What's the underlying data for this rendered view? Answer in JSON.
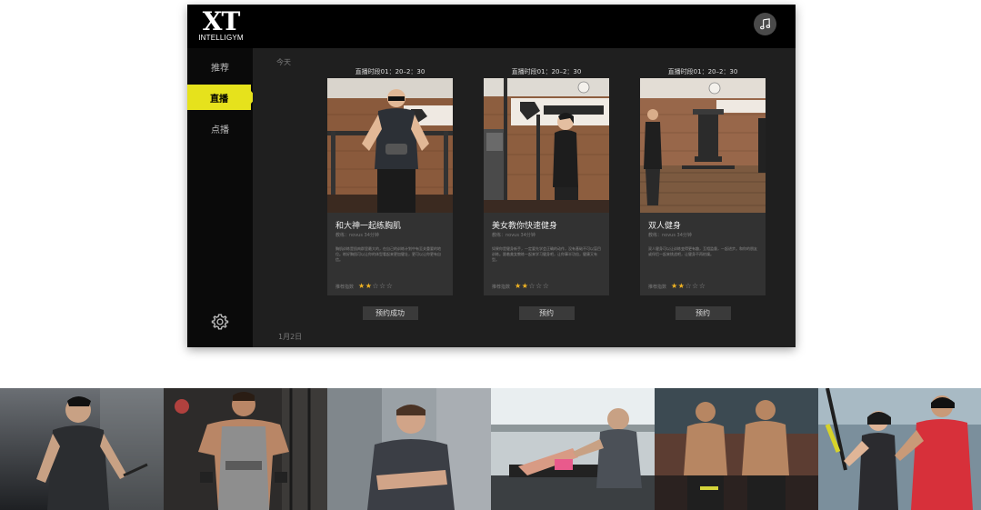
{
  "app": {
    "logo": {
      "main": "XT",
      "sub": "INTELLIGYM"
    },
    "sidebar": {
      "items": [
        {
          "label": "推荐",
          "active": false
        },
        {
          "label": "直播",
          "active": true
        },
        {
          "label": "点播",
          "active": false
        }
      ]
    },
    "main": {
      "date_top": "今天",
      "date_bottom": "1月2日",
      "cards": [
        {
          "time": "直播时段01：20–2：30",
          "title": "和大神一起练胸肌",
          "coach": "教练：novus 34分钟",
          "description": "胸肌训练是肌肉群里最大的，在自己的训练计划中有至关重要的地位。练好胸肌可以让你的体型看起来更加健壮，更可以让你更有自信。",
          "rating_label": "推荐指数",
          "rating": 2,
          "rating_max": 5,
          "button": "预约成功"
        },
        {
          "time": "直播时段01：20–2：30",
          "title": "美女教你快速健身",
          "coach": "教练：novus 34分钟",
          "description": "如果你是健身新手，一定要先学会正确的动作，没有基础不可以盲目训练。跟着美女教练一起来学习健身吧，让你事半功倍，健康又有型。",
          "rating_label": "推荐指数",
          "rating": 2,
          "rating_max": 5,
          "button": "预约"
        },
        {
          "time": "直播时段01：20–2：30",
          "title": "双人健身",
          "coach": "教练：novus 34分钟",
          "description": "双人健身可以让训练变得更有趣，互相监督，一起进步。和你的朋友或伴侣一起来挑战吧，让健身不再枯燥。",
          "rating_label": "推荐指数",
          "rating": 2,
          "rating_max": 5,
          "button": "预约"
        }
      ]
    },
    "icons": {
      "music": "music-note-icon",
      "settings": "gear-icon"
    }
  },
  "colors": {
    "accent": "#e6e21c",
    "star": "#f0b323",
    "card_bg": "#323232",
    "window_bg": "#1f1f1f"
  },
  "photo_strip": [
    "man-in-tank-top-holding-rope",
    "muscular-man-in-gym",
    "smiling-man-arms-crossed",
    "trainer-assisting-woman-on-bench",
    "two-bodybuilders-posing",
    "trainer-with-woman-using-trx"
  ]
}
